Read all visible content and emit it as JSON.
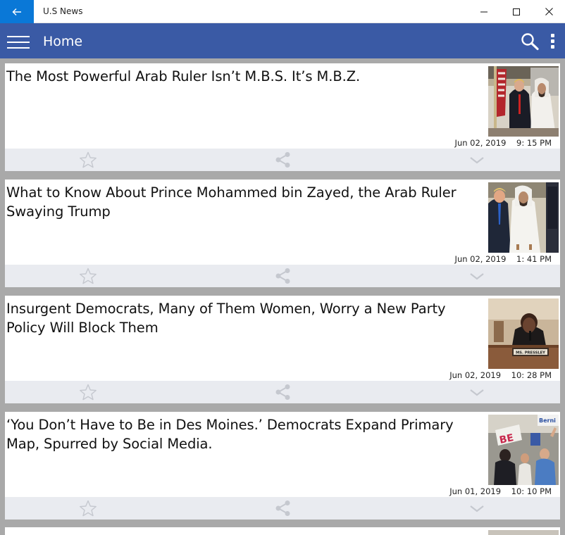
{
  "window": {
    "title": "U.S News"
  },
  "appbar": {
    "title": "Home"
  },
  "articles": [
    {
      "title": "The Most Powerful Arab Ruler Isn’t M.B.S. It’s M.B.Z.",
      "date": "Jun 02, 2019    9: 15 PM"
    },
    {
      "title": "What to Know About Prince Mohammed bin Zayed, the Arab Ruler Swaying Trump",
      "date": "Jun 02, 2019    1: 41 PM"
    },
    {
      "title": "Insurgent Democrats, Many of Them Women, Worry a New Party Policy Will Block Them",
      "date": "Jun 02, 2019    10: 28 PM"
    },
    {
      "title": "‘You Don’t Have to Be in Des Moines.’ Democrats Expand Primary Map, Spurred by Social Media.",
      "date": "Jun 01, 2019    10: 10 PM"
    }
  ],
  "photo_text": {
    "nameplate": "MS. PRESSLEY",
    "sign": "BE",
    "sign_right": "Berni"
  },
  "colors": {
    "accent": "#0a78d7",
    "appbar": "#3a5aa5",
    "feed_bg": "#a9a9a9",
    "action_bar": "#e9ebf0",
    "icon_gray": "#c5c8cf"
  },
  "icons": {
    "back": "arrow-left-icon",
    "minimize": "minimize-icon",
    "maximize": "maximize-icon",
    "close": "close-icon",
    "menu": "hamburger-icon",
    "search": "search-icon",
    "more": "more-vertical-icon",
    "favorite": "star-icon",
    "share": "share-icon",
    "expand": "chevron-down-icon"
  }
}
